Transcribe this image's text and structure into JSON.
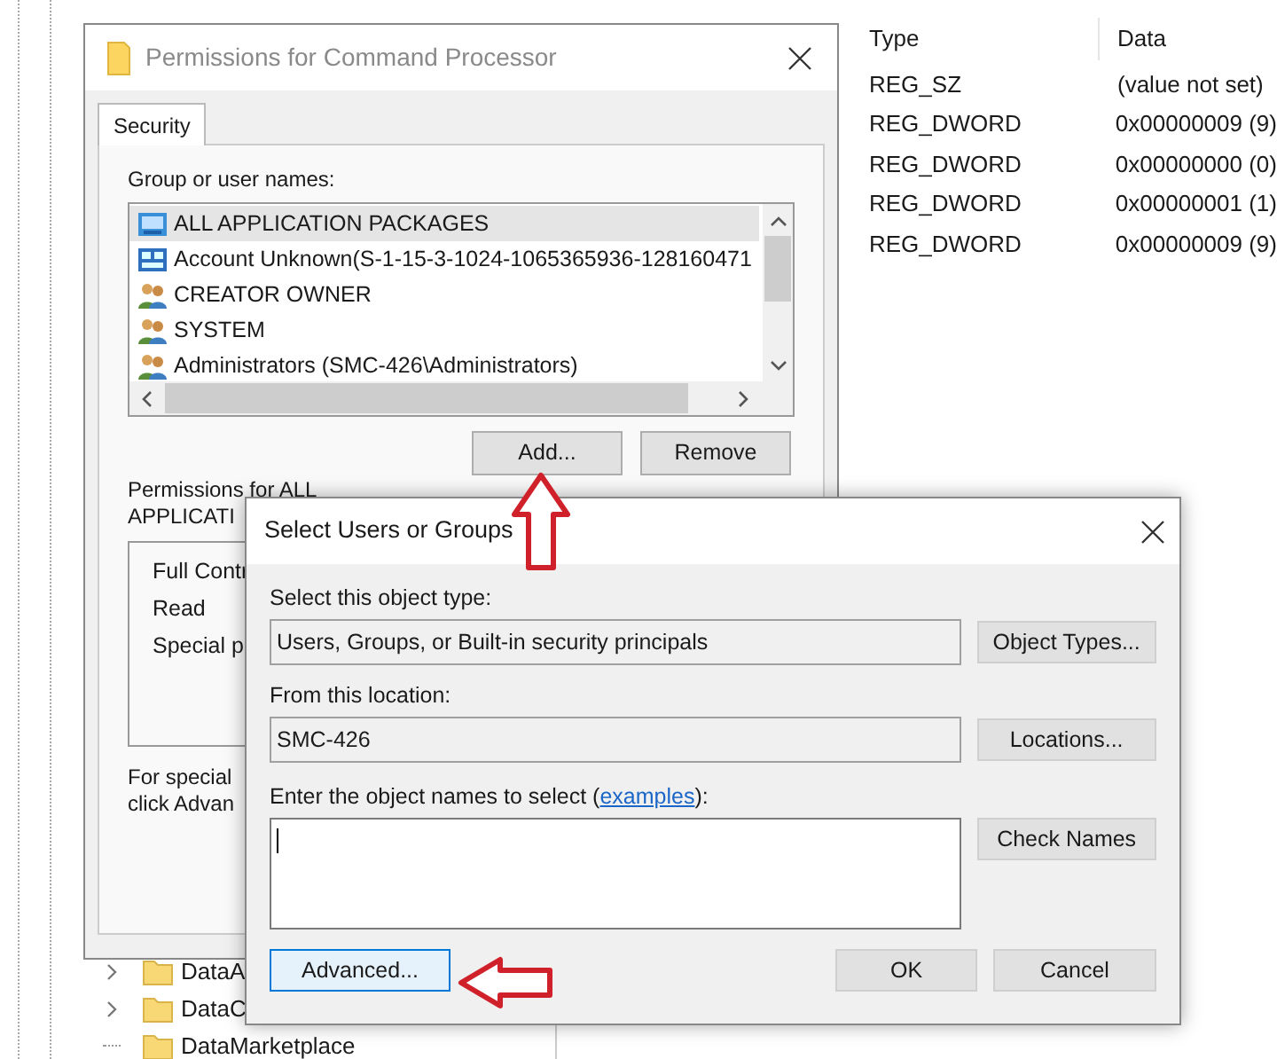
{
  "registry_values": {
    "columns": [
      "Type",
      "Data"
    ],
    "rows": [
      {
        "type": "REG_SZ",
        "data": "(value not set)"
      },
      {
        "type": "REG_DWORD",
        "data": "0x00000009 (9)"
      },
      {
        "type": "REG_DWORD",
        "data": "0x00000000 (0)"
      },
      {
        "type": "REG_DWORD",
        "data": "0x00000001 (1)"
      },
      {
        "type": "REG_DWORD",
        "data": "0x00000009 (9)"
      }
    ]
  },
  "registry_tree": [
    {
      "label": "DataA",
      "has_children": true
    },
    {
      "label": "DataC",
      "has_children": true
    },
    {
      "label": "DataMarketplace",
      "has_children": false
    }
  ],
  "permissions_window": {
    "title": "Permissions for Command Processor",
    "tabs": [
      {
        "label": "Security",
        "selected": true
      }
    ],
    "group_label": "Group or user names:",
    "users": [
      {
        "name": "ALL APPLICATION PACKAGES",
        "kind": "package",
        "selected": true
      },
      {
        "name": "Account Unknown(S-1-15-3-1024-1065365936-128160471",
        "kind": "account",
        "selected": false
      },
      {
        "name": "CREATOR OWNER",
        "kind": "group",
        "selected": false
      },
      {
        "name": "SYSTEM",
        "kind": "group",
        "selected": false
      },
      {
        "name": "Administrators (SMC-426\\Administrators)",
        "kind": "group",
        "selected": false
      }
    ],
    "buttons": [
      "Add...",
      "Remove"
    ],
    "permissions_label": [
      "Permissions for ALL",
      "APPLICATI"
    ],
    "permissions": [
      "Full Contr",
      "Read",
      "Special p"
    ],
    "advanced_note": [
      "For special",
      "click Advan"
    ]
  },
  "select_dialog": {
    "title": "Select Users or Groups",
    "object_type_label": "Select this object type:",
    "object_type": "Users, Groups, or Built-in security principals",
    "object_types_button": "Object Types...",
    "location_label": "From this location:",
    "location": "SMC-426",
    "locations_button": "Locations...",
    "names_label_before": "Enter the object names to select (",
    "names_label_link": "examples",
    "names_label_after": "):",
    "check_names_button": "Check Names",
    "advanced_button": "Advanced...",
    "ok_button": "OK",
    "cancel_button": "Cancel"
  }
}
